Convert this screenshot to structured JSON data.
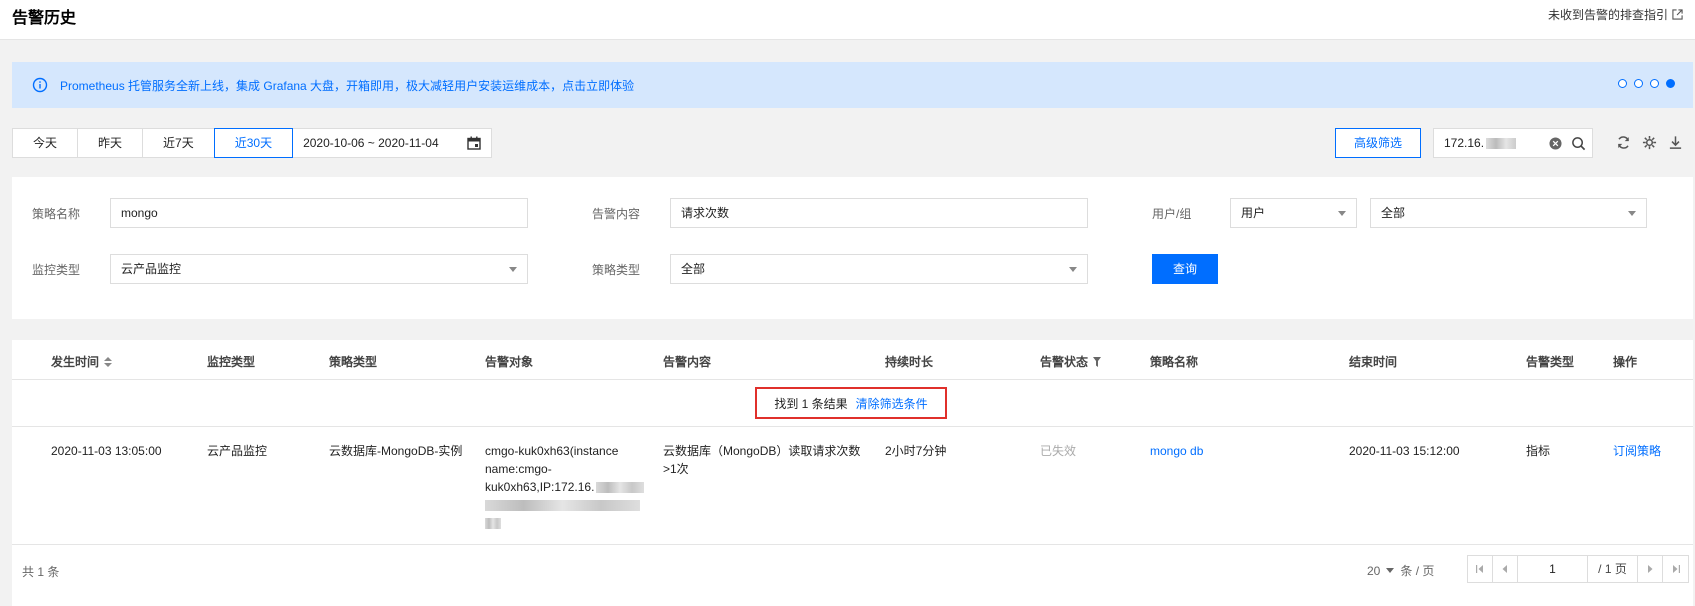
{
  "header": {
    "title": "告警历史",
    "guide_link": "未收到告警的排查指引"
  },
  "banner": {
    "message": "Prometheus 托管服务全新上线，集成 Grafana 大盘，开箱即用，极大减轻用户安装运维成本，点击立即体验",
    "dots": 4,
    "active_dot": 4
  },
  "toolbar": {
    "ranges": [
      "今天",
      "昨天",
      "近7天",
      "近30天"
    ],
    "active_range": "近30天",
    "date_range": "2020-10-06 ~ 2020-11-04",
    "advanced_filter": "高级筛选",
    "search_value": "172.16."
  },
  "filters": {
    "policy_name_label": "策略名称",
    "policy_name_value": "mongo",
    "alarm_content_label": "告警内容",
    "alarm_content_value": "请求次数",
    "user_group_label": "用户/组",
    "user_group_type": "用户",
    "user_group_value": "全部",
    "monitor_type_label": "监控类型",
    "monitor_type_value": "云产品监控",
    "policy_type_label": "策略类型",
    "policy_type_value": "全部",
    "query_button": "查询"
  },
  "table": {
    "columns": [
      "发生时间",
      "监控类型",
      "策略类型",
      "告警对象",
      "告警内容",
      "持续时长",
      "告警状态",
      "策略名称",
      "结束时间",
      "告警类型",
      "操作"
    ],
    "result_text": "找到 1 条结果",
    "clear_filters": "清除筛选条件",
    "rows": [
      {
        "time": "2020-11-03 13:05:00",
        "monitor_type": "云产品监控",
        "policy_type": "云数据库-MongoDB-实例",
        "target_line1": "cmgo-kuk0xh63(instance",
        "target_line2": "name:cmgo-",
        "target_line3": "kuk0xh63,IP:172.16.",
        "content_line1": "云数据库（MongoDB）读取请求次数",
        "content_line2": ">1次",
        "duration": "2小时7分钟",
        "status": "已失效",
        "policy_name": "mongo db",
        "end_time": "2020-11-03 15:12:00",
        "alarm_type": "指标",
        "action": "订阅策略"
      }
    ]
  },
  "footer": {
    "total": "共 1 条",
    "page_size": "20",
    "page_size_unit": "条 / 页",
    "current_page": "1",
    "total_pages": "/ 1 页"
  },
  "colors": {
    "accent": "#006eff",
    "banner_bg": "#d5e7fd",
    "highlight_border": "#e0302b"
  }
}
